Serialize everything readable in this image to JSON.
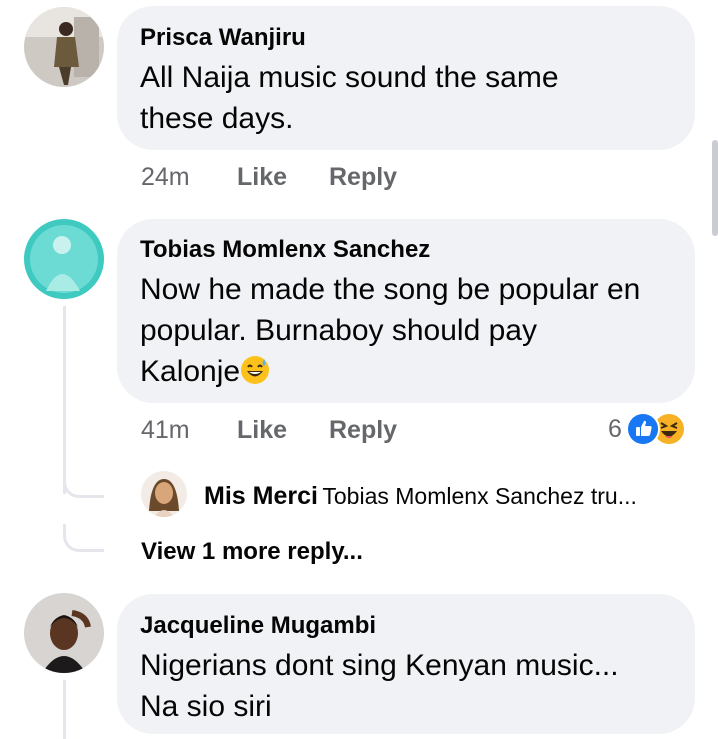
{
  "comments": [
    {
      "author": "Prisca Wanjiru",
      "text_lines": [
        "All Naija music sound the same",
        "these days."
      ],
      "time": "24m",
      "like": "Like",
      "reply": "Reply"
    },
    {
      "author": "Tobias Momlenx Sanchez",
      "text_lines": [
        "Now he made the song be popular en",
        "popular. Burnaboy should pay",
        "Kalonje"
      ],
      "emoji": "grinning-sweat-emoji",
      "time": "41m",
      "like": "Like",
      "reply": "Reply",
      "reaction_count": "6",
      "reaction_icons": [
        "like-reaction-icon",
        "haha-reaction-icon"
      ],
      "reply_preview": {
        "author": "Mis Merci",
        "text": "Tobias Momlenx Sanchez tru..."
      },
      "view_more": "View 1 more reply..."
    },
    {
      "author": "Jacqueline Mugambi",
      "text_lines": [
        "Nigerians dont sing Kenyan music...",
        "Na sio siri"
      ]
    }
  ],
  "colors": {
    "bubble": "#f0f2f5",
    "text": "#050505",
    "meta": "#65676b",
    "like_blue": "#1877f2",
    "haha_yellow": "#f7b125"
  }
}
